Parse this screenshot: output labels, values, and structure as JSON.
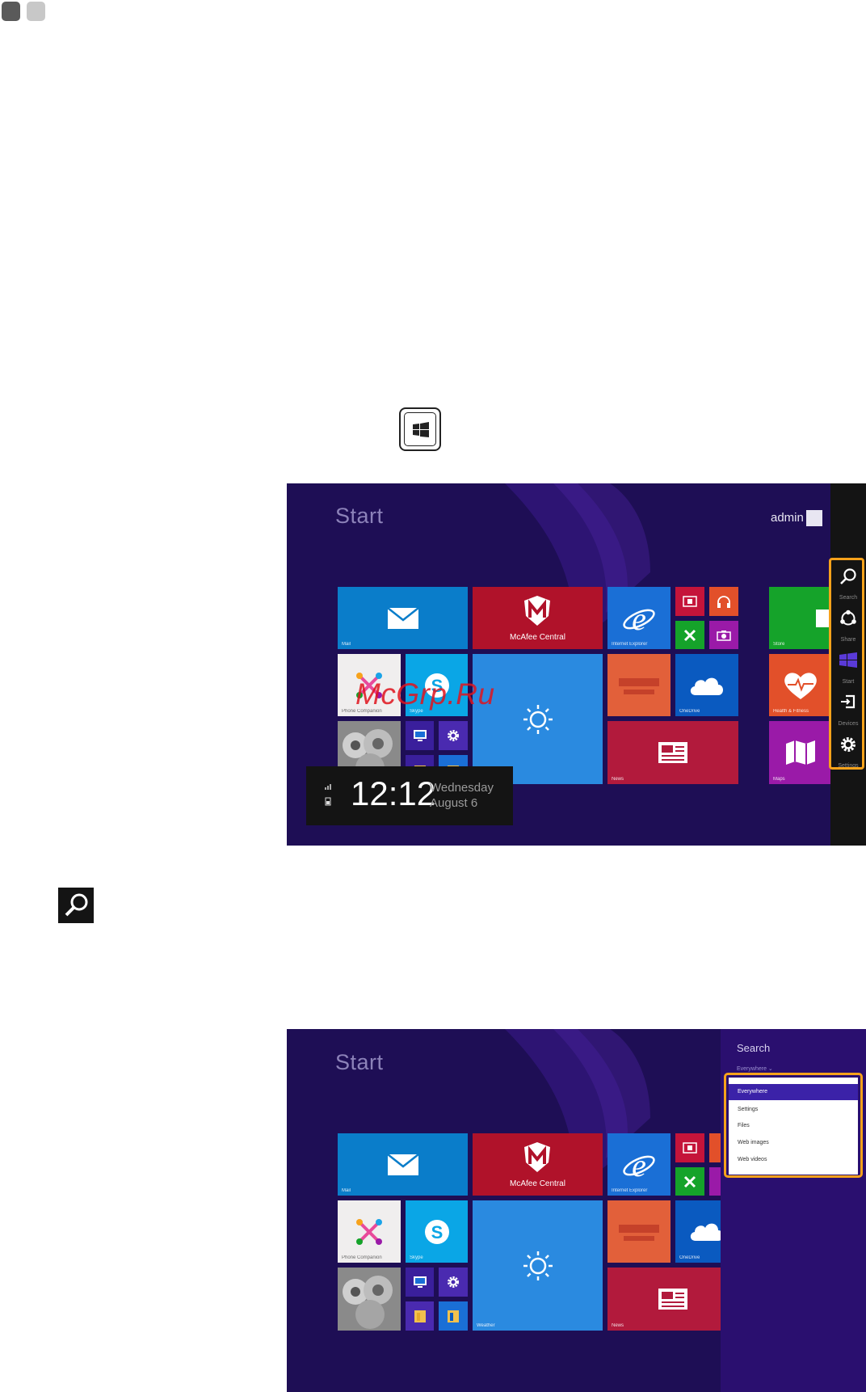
{
  "page_marks": [
    "dark",
    "light"
  ],
  "screens": [
    {
      "start_title": "Start",
      "user_name": "admin",
      "tiles": {
        "mail": "Mail",
        "mcafee": "McAfee Central",
        "ie": "Internet Explorer",
        "phone": "Phone Companion",
        "skype": "Skype",
        "onedrive": "OneDrive",
        "news": "News",
        "photos": "Photos",
        "store": "Store",
        "health": "Health & Fitness",
        "maps": "Maps",
        "weather": "Weather"
      }
    },
    {
      "start_title": "Start",
      "tiles": {
        "mail": "Mail",
        "mcafee": "McAfee Central",
        "ie": "Internet Explorer",
        "phone": "Phone Companion",
        "skype": "Skype",
        "onedrive": "OneDrive",
        "news": "News",
        "weather": "Weather"
      }
    }
  ],
  "clock": {
    "time": "12:12",
    "day": "Wednesday",
    "date": "August 6"
  },
  "charms": [
    "Search",
    "Share",
    "Start",
    "Devices",
    "Settings"
  ],
  "search_pane": {
    "title": "Search",
    "scope": "Everywhere ⌄",
    "options": [
      "Everywhere",
      "Settings",
      "Files",
      "Web images",
      "Web videos"
    ],
    "selected": "Everywhere"
  },
  "watermark": "McGrp.Ru",
  "colors": {
    "start_bg": "#1e0e55",
    "highlight": "#f7a21b",
    "mail": "#0a7dca",
    "mcafee": "#b0122a",
    "ie": "#1a6fd6",
    "skype": "#0aa6e6",
    "weather": "#2a8ae0",
    "onedrive": "#0a5ac0",
    "news": "#b21a3c",
    "store": "#15a32a",
    "health": "#e2502a",
    "maps": "#9a1aa8"
  }
}
